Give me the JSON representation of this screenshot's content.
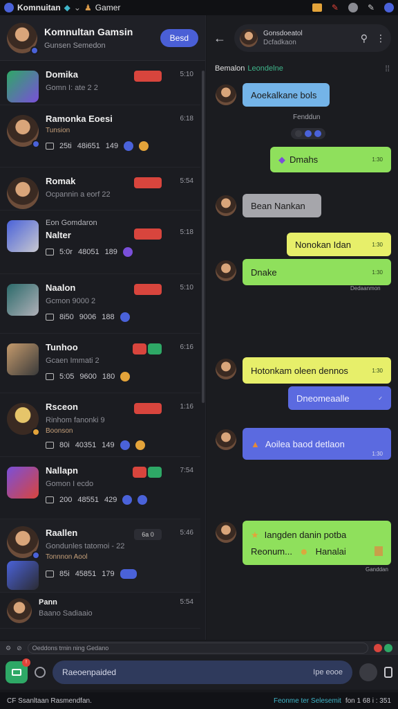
{
  "titlebar": {
    "app_title": "Komnuitan",
    "game_label": "Gamer"
  },
  "group": {
    "title": "Komnultan Gamsin",
    "subtitle": "Gunsen Semedon",
    "join_label": "Besd"
  },
  "chats": [
    {
      "name": "Domika",
      "sub": "Gomn I: ate 2 2",
      "time": "5:10"
    },
    {
      "name": "Ramonka Eoesi",
      "sub2": "Tunsion",
      "meta": [
        "25ti",
        "48i651",
        "149"
      ],
      "time": "6:18"
    },
    {
      "name": "Romak",
      "sub": "Ocpannin a eorf 22",
      "time": "5:54"
    },
    {
      "pre": "Eon Gomdaron",
      "name": "Nalter",
      "meta": [
        "5:0r",
        "48051",
        "189"
      ],
      "time": "5:18"
    },
    {
      "name": "Naalon",
      "sub": "Gcmon 9000 2",
      "meta": [
        "8i50",
        "9006",
        "188"
      ],
      "time": "5:10"
    },
    {
      "name": "Tunhoo",
      "sub": "Gcaen Immati 2",
      "meta": [
        "5:05",
        "9600",
        "180"
      ],
      "time": "6:16"
    },
    {
      "name": "Rsceon",
      "sub": "Rinhom fanonki 9",
      "sub2": "Boonson",
      "meta": [
        "80i",
        "40351",
        "149"
      ],
      "time": "1:16"
    },
    {
      "name": "Nallapn",
      "sub": "Gomon I ecdo",
      "meta": [
        "200",
        "48551",
        "429"
      ],
      "time": "7:54"
    },
    {
      "name": "Raallen",
      "sub": "Gondunles tatomoi - 22",
      "sub2": "Tonnnon Aool",
      "meta": [
        "85i",
        "45851",
        "179"
      ],
      "badge": "6a 0",
      "time": "5:46"
    },
    {
      "name": "Pann",
      "sub": "Baano Sadiaaio",
      "time": "5:54"
    }
  ],
  "chat_header": {
    "title": "Gonsdoeatol",
    "subtitle": "Dcfadkaon"
  },
  "typing": {
    "who": "Bemalon",
    "tag": "Leondelne"
  },
  "messages": [
    {
      "text": "Aoekalkane bols",
      "kind": "in"
    },
    {
      "text": "Fenddun",
      "kind": "system"
    },
    {
      "text": "Dmahs",
      "time": "1:30",
      "kind": "out"
    },
    {
      "text": "Bean Nankan",
      "kind": "in"
    },
    {
      "text": "Nonokan Idan",
      "time": "1:30",
      "kind": "out"
    },
    {
      "text": "Dnake",
      "time": "1:30",
      "kind": "out",
      "note": "Dedaanmon"
    },
    {
      "text": "Hotonkam oleen dennos",
      "time": "1:30",
      "kind": "out"
    },
    {
      "text": "Dneomeaalle",
      "kind": "out"
    },
    {
      "text": "Aoilea baod detlaon",
      "time": "1:30",
      "kind": "out"
    },
    {
      "text": "Iangden danin potba",
      "line2": "Reonum...",
      "line2b": "Hanalai",
      "kind": "out",
      "note": "Ganddan"
    }
  ],
  "status_strip": {
    "left": "Oeddons trnin ning Gedano"
  },
  "composer": {
    "placeholder": "Raeoenpaided",
    "right_label": "Ipe eooe"
  },
  "footer": {
    "left": "CF Ssanltaan Rasmendfan.",
    "right": "Feonme ter Selesemit",
    "right2": "fon 1 68 i : 351"
  },
  "colors": {
    "accent": "#4a5fd6",
    "bubble_green": "#8fe05c",
    "bubble_purple": "#5b6ae0",
    "bubble_grey": "#a6a6ab",
    "bubble_blue": "#74b4e8",
    "bubble_yellow": "#e7ef6a"
  }
}
